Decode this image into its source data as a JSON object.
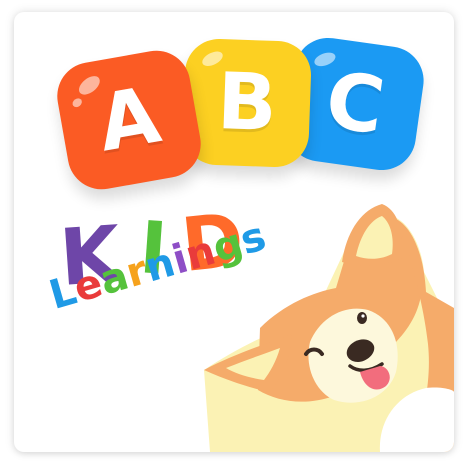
{
  "logo": {
    "blocks": [
      {
        "letter": "A",
        "color": "#fb5b24",
        "name": "letter-a"
      },
      {
        "letter": "B",
        "color": "#fcd022",
        "name": "letter-b"
      },
      {
        "letter": "C",
        "color": "#1b9af3",
        "name": "letter-c"
      }
    ],
    "kid_letters": [
      {
        "char": "K",
        "color": "#6e46a8"
      },
      {
        "char": "I",
        "color": "#55c23c"
      },
      {
        "char": "D",
        "color": "#ff6a2a"
      }
    ],
    "learnings_letters": [
      {
        "char": "L",
        "color": "#1f9ae6"
      },
      {
        "char": "e",
        "color": "#e93b3b"
      },
      {
        "char": "a",
        "color": "#55c23c"
      },
      {
        "char": "r",
        "color": "#f6a21c"
      },
      {
        "char": "n",
        "color": "#1f9ae6"
      },
      {
        "char": "i",
        "color": "#8e4ec6"
      },
      {
        "char": "n",
        "color": "#e93b3b"
      },
      {
        "char": "g",
        "color": "#55c23c"
      },
      {
        "char": "s",
        "color": "#1f9ae6"
      }
    ]
  },
  "mascot": {
    "name": "corgi",
    "fur_color": "#f5ab6a",
    "cheek_color": "#fbf2b4"
  }
}
